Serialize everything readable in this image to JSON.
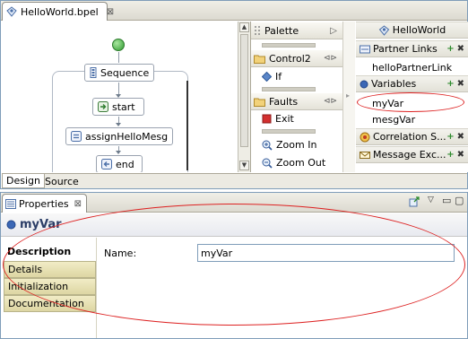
{
  "editor": {
    "tab_title": "HelloWorld.bpel",
    "tab_close": "⊠",
    "bottom_tabs": [
      "Design",
      "Source"
    ]
  },
  "canvas": {
    "sequence_label": "Sequence",
    "activities": [
      "start",
      "assignHelloMesg",
      "end"
    ]
  },
  "palette": {
    "header": "Palette",
    "header_arrow": "▷",
    "drawers": [
      {
        "label": "Control2",
        "items": [
          "If"
        ]
      },
      {
        "label": "Faults",
        "items": [
          "Exit"
        ]
      }
    ],
    "zoom_in": "Zoom In",
    "zoom_out": "Zoom Out"
  },
  "partners_panel": {
    "process_name": "HelloWorld",
    "partner_links_header": "Partner Links",
    "partner_links": [
      "helloPartnerLink"
    ],
    "variables_header": "Variables",
    "variables": [
      "myVar",
      "mesgVar"
    ],
    "correlation_header": "Correlation S...",
    "message_exchange_header": "Message Exc...",
    "plus": "+",
    "cross": "✖"
  },
  "properties": {
    "view_title": "Properties",
    "view_close": "⊠",
    "selection_title": "myVar",
    "tabs": [
      "Description",
      "Details",
      "Initialization",
      "Documentation"
    ],
    "selected_tab": "Description",
    "name_label": "Name:",
    "name_value": "myVar"
  },
  "colors": {
    "annotation_red": "#d22222",
    "tab_tan": "#ddd6a3",
    "title_blue": "#2b3d66"
  }
}
